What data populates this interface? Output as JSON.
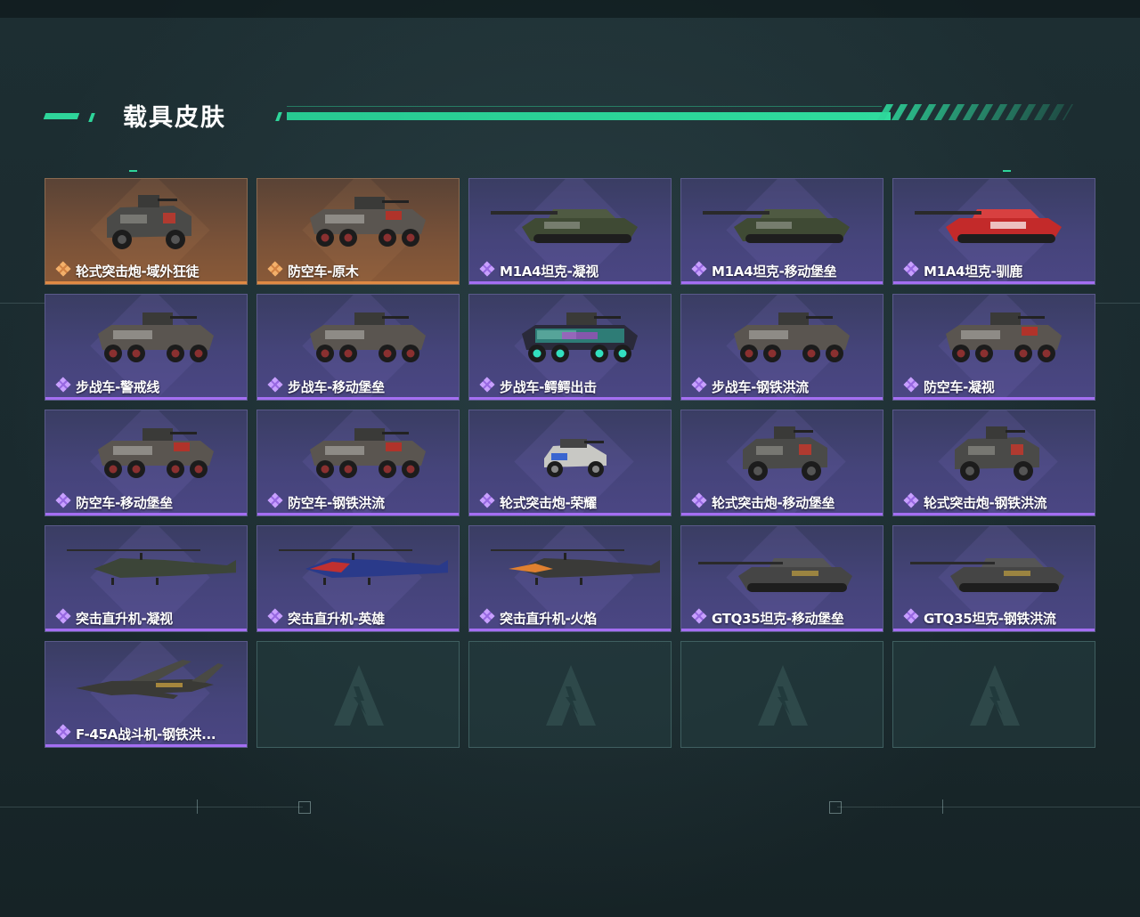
{
  "page": {
    "title": "载具皮肤",
    "accent_color": "#2ed59a"
  },
  "colors": {
    "purple_card": "#45447a",
    "purple_bar": "#a46ef2",
    "orange_card": "#7a5238",
    "orange_bar": "#e08a44",
    "empty_card": "#233a3e"
  },
  "skins": [
    {
      "name": "轮式突击炮-域外狂徒",
      "rarity": "orange",
      "type": "armored-car",
      "icon": "rarity-orange-icon"
    },
    {
      "name": "防空车-原木",
      "rarity": "orange",
      "type": "apc-aa",
      "icon": "rarity-orange-icon"
    },
    {
      "name": "M1A4坦克-凝视",
      "rarity": "purple",
      "type": "tank",
      "icon": "rarity-purple-icon"
    },
    {
      "name": "M1A4坦克-移动堡垒",
      "rarity": "purple",
      "type": "tank",
      "icon": "rarity-purple-icon"
    },
    {
      "name": "M1A4坦克-驯鹿",
      "rarity": "purple",
      "type": "tank-red",
      "icon": "rarity-purple-icon"
    },
    {
      "name": "步战车-警戒线",
      "rarity": "purple",
      "type": "apc",
      "icon": "rarity-purple-icon"
    },
    {
      "name": "步战车-移动堡垒",
      "rarity": "purple",
      "type": "apc",
      "icon": "rarity-purple-icon"
    },
    {
      "name": "步战车-鳄鳄出击",
      "rarity": "purple",
      "type": "apc-graffiti",
      "icon": "rarity-purple-icon"
    },
    {
      "name": "步战车-钢铁洪流",
      "rarity": "purple",
      "type": "apc",
      "icon": "rarity-purple-icon"
    },
    {
      "name": "防空车-凝视",
      "rarity": "purple",
      "type": "apc-aa",
      "icon": "rarity-purple-icon"
    },
    {
      "name": "防空车-移动堡垒",
      "rarity": "purple",
      "type": "apc-aa",
      "icon": "rarity-purple-icon"
    },
    {
      "name": "防空车-钢铁洪流",
      "rarity": "purple",
      "type": "apc-aa",
      "icon": "rarity-purple-icon"
    },
    {
      "name": "轮式突击炮-荣耀",
      "rarity": "purple",
      "type": "buggy",
      "icon": "rarity-purple-icon"
    },
    {
      "name": "轮式突击炮-移动堡垒",
      "rarity": "purple",
      "type": "armored-car",
      "icon": "rarity-purple-icon"
    },
    {
      "name": "轮式突击炮-钢铁洪流",
      "rarity": "purple",
      "type": "armored-car",
      "icon": "rarity-purple-icon"
    },
    {
      "name": "突击直升机-凝视",
      "rarity": "purple",
      "type": "helicopter",
      "icon": "rarity-purple-icon"
    },
    {
      "name": "突击直升机-英雄",
      "rarity": "purple",
      "type": "helicopter-hero",
      "icon": "rarity-purple-icon"
    },
    {
      "name": "突击直升机-火焰",
      "rarity": "purple",
      "type": "helicopter-fire",
      "icon": "rarity-purple-icon"
    },
    {
      "name": "GTQ35坦克-移动堡垒",
      "rarity": "purple",
      "type": "tank-long",
      "icon": "rarity-purple-icon"
    },
    {
      "name": "GTQ35坦克-钢铁洪流",
      "rarity": "purple",
      "type": "tank-long",
      "icon": "rarity-purple-icon"
    },
    {
      "name": "F-45A战斗机-钢铁洪...",
      "rarity": "purple",
      "type": "jet",
      "icon": "rarity-purple-icon"
    },
    {
      "name": "",
      "rarity": "empty",
      "type": "empty",
      "icon": "logo-watermark-icon"
    },
    {
      "name": "",
      "rarity": "empty",
      "type": "empty",
      "icon": "logo-watermark-icon"
    },
    {
      "name": "",
      "rarity": "empty",
      "type": "empty",
      "icon": "logo-watermark-icon"
    },
    {
      "name": "",
      "rarity": "empty",
      "type": "empty",
      "icon": "logo-watermark-icon"
    }
  ]
}
